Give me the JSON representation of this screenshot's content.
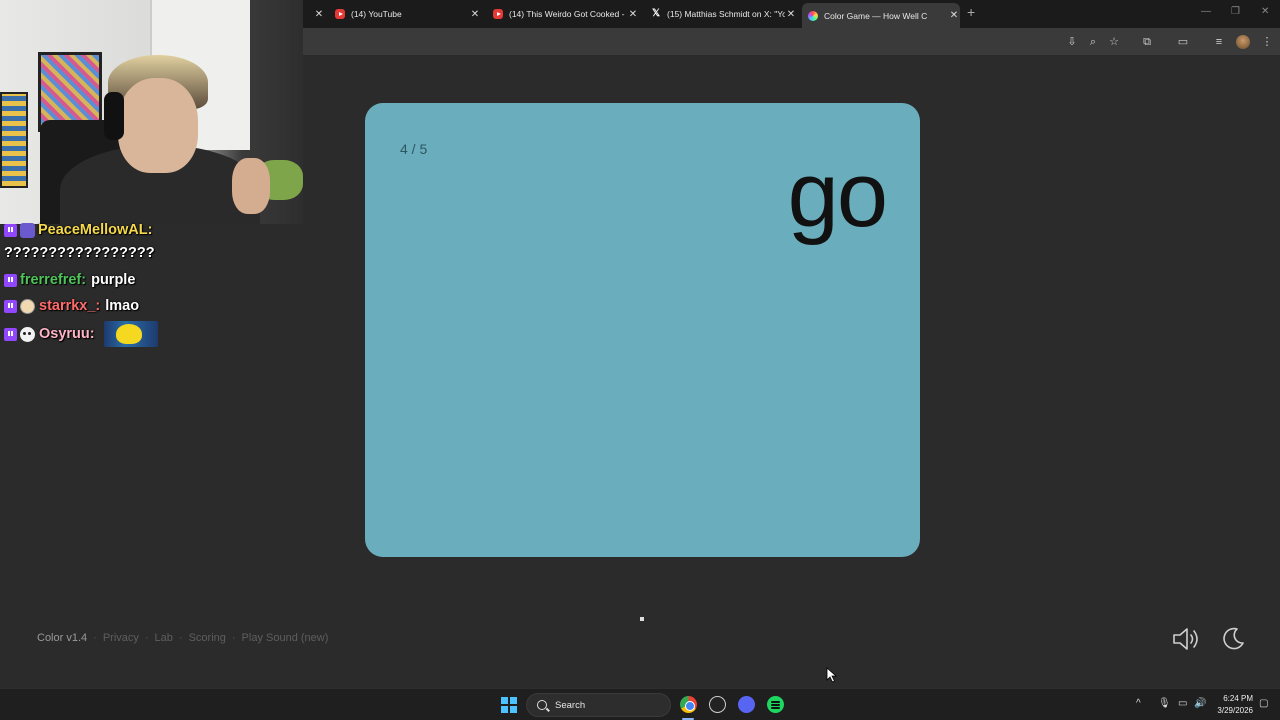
{
  "browser": {
    "tabs": [
      {
        "title": "(14) YouTube",
        "icon": "youtube-icon"
      },
      {
        "title": "(14) This Weirdo Got Cooked -",
        "icon": "youtube-icon"
      },
      {
        "title": "(15) Matthias Schmidt on X: \"Yo",
        "icon": "x-icon"
      },
      {
        "title": "Color Game — How Well C",
        "icon": "color-game-icon",
        "active": true
      }
    ]
  },
  "chat": {
    "messages": [
      {
        "user": "PeaceMellowAL:",
        "user_color": "#f5d94a",
        "text": "?????????????????"
      },
      {
        "user": "frerrefref:",
        "user_color": "#4fc45a",
        "text": "purple"
      },
      {
        "user": "starrkx_:",
        "user_color": "#ff6b6b",
        "text": "lmao"
      },
      {
        "user": "Osyruu:",
        "user_color": "#ffb3c6",
        "text": ""
      }
    ]
  },
  "game": {
    "counter": "4 / 5",
    "word": "go",
    "card_color": "#6aaebd"
  },
  "footer": {
    "brand": "Color v1.4",
    "links": [
      "Privacy",
      "Lab",
      "Scoring",
      "Play Sound (new)"
    ]
  },
  "taskbar": {
    "search_label": "Search",
    "time": "6:24 PM",
    "date": "3/29/2026"
  }
}
